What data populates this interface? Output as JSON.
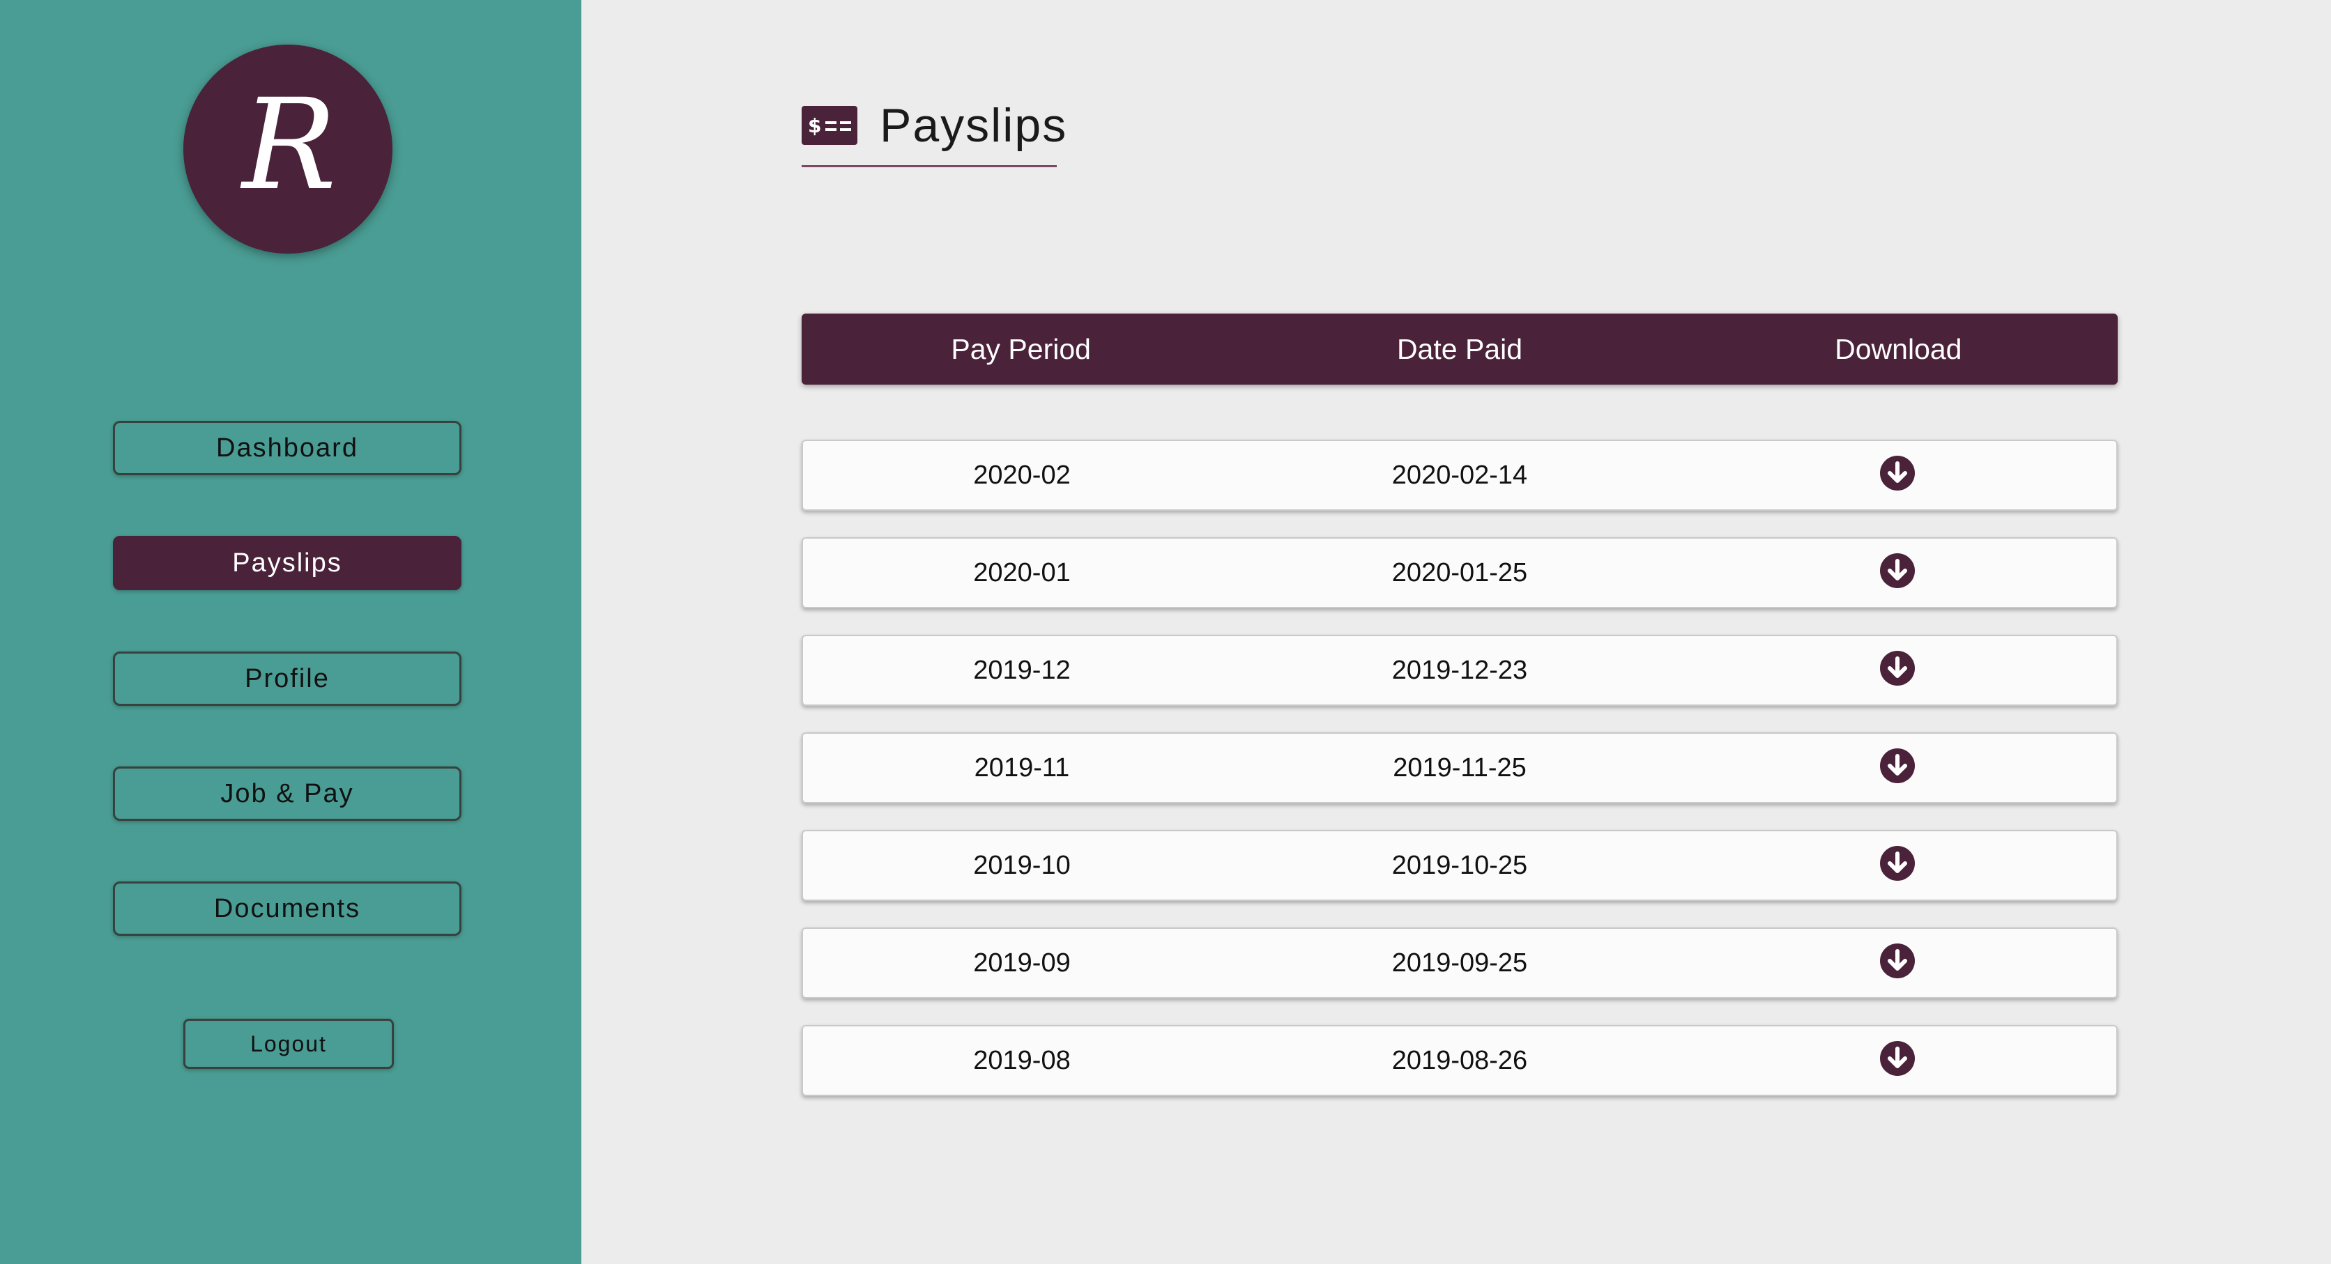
{
  "brand": {
    "logo_letter": "R",
    "logo_color": "#4a2239",
    "sidebar_color": "#4a9d94"
  },
  "sidebar": {
    "items": [
      {
        "label": "Dashboard",
        "active": false
      },
      {
        "label": "Payslips",
        "active": true
      },
      {
        "label": "Profile",
        "active": false
      },
      {
        "label": "Job & Pay",
        "active": false
      },
      {
        "label": "Documents",
        "active": false
      }
    ],
    "logout_label": "Logout"
  },
  "header": {
    "icon": "payslip-card-icon",
    "title": "Payslips"
  },
  "table": {
    "columns": [
      "Pay Period",
      "Date Paid",
      "Download"
    ],
    "download_icon": "download-circle-icon",
    "rows": [
      {
        "period": "2020-02",
        "date_paid": "2020-02-14"
      },
      {
        "period": "2020-01",
        "date_paid": "2020-01-25"
      },
      {
        "period": "2019-12",
        "date_paid": "2019-12-23"
      },
      {
        "period": "2019-11",
        "date_paid": "2019-11-25"
      },
      {
        "period": "2019-10",
        "date_paid": "2019-10-25"
      },
      {
        "period": "2019-09",
        "date_paid": "2019-09-25"
      },
      {
        "period": "2019-08",
        "date_paid": "2019-08-26"
      }
    ]
  }
}
